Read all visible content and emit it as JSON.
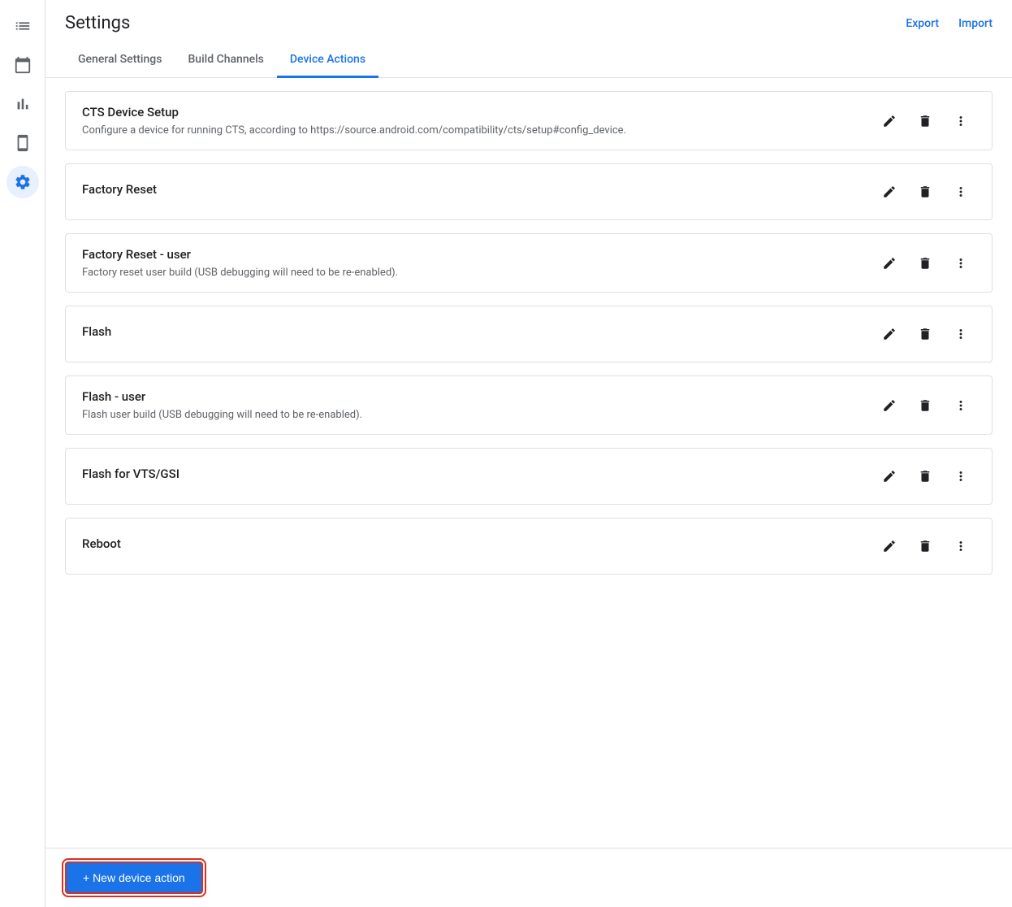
{
  "header": {
    "title": "Settings",
    "export_label": "Export",
    "import_label": "Import"
  },
  "tabs": [
    {
      "id": "general",
      "label": "General Settings",
      "active": false
    },
    {
      "id": "build",
      "label": "Build Channels",
      "active": false
    },
    {
      "id": "device",
      "label": "Device Actions",
      "active": true
    }
  ],
  "actions": [
    {
      "id": "cts",
      "title": "CTS Device Setup",
      "description": "Configure a device for running CTS, according to https://source.android.com/compatibility/cts/setup#config_device."
    },
    {
      "id": "factory-reset",
      "title": "Factory Reset",
      "description": ""
    },
    {
      "id": "factory-reset-user",
      "title": "Factory Reset - user",
      "description": "Factory reset user build (USB debugging will need to be re-enabled)."
    },
    {
      "id": "flash",
      "title": "Flash",
      "description": ""
    },
    {
      "id": "flash-user",
      "title": "Flash - user",
      "description": "Flash user build (USB debugging will need to be re-enabled)."
    },
    {
      "id": "flash-vts",
      "title": "Flash for VTS/GSI",
      "description": ""
    },
    {
      "id": "reboot",
      "title": "Reboot",
      "description": ""
    }
  ],
  "footer": {
    "new_action_label": "+ New device action"
  },
  "sidebar": {
    "items": [
      {
        "id": "list",
        "icon": "list",
        "active": false
      },
      {
        "id": "calendar",
        "icon": "calendar",
        "active": false
      },
      {
        "id": "chart",
        "icon": "chart",
        "active": false
      },
      {
        "id": "device",
        "icon": "device",
        "active": false
      },
      {
        "id": "settings",
        "icon": "settings",
        "active": true
      }
    ]
  }
}
